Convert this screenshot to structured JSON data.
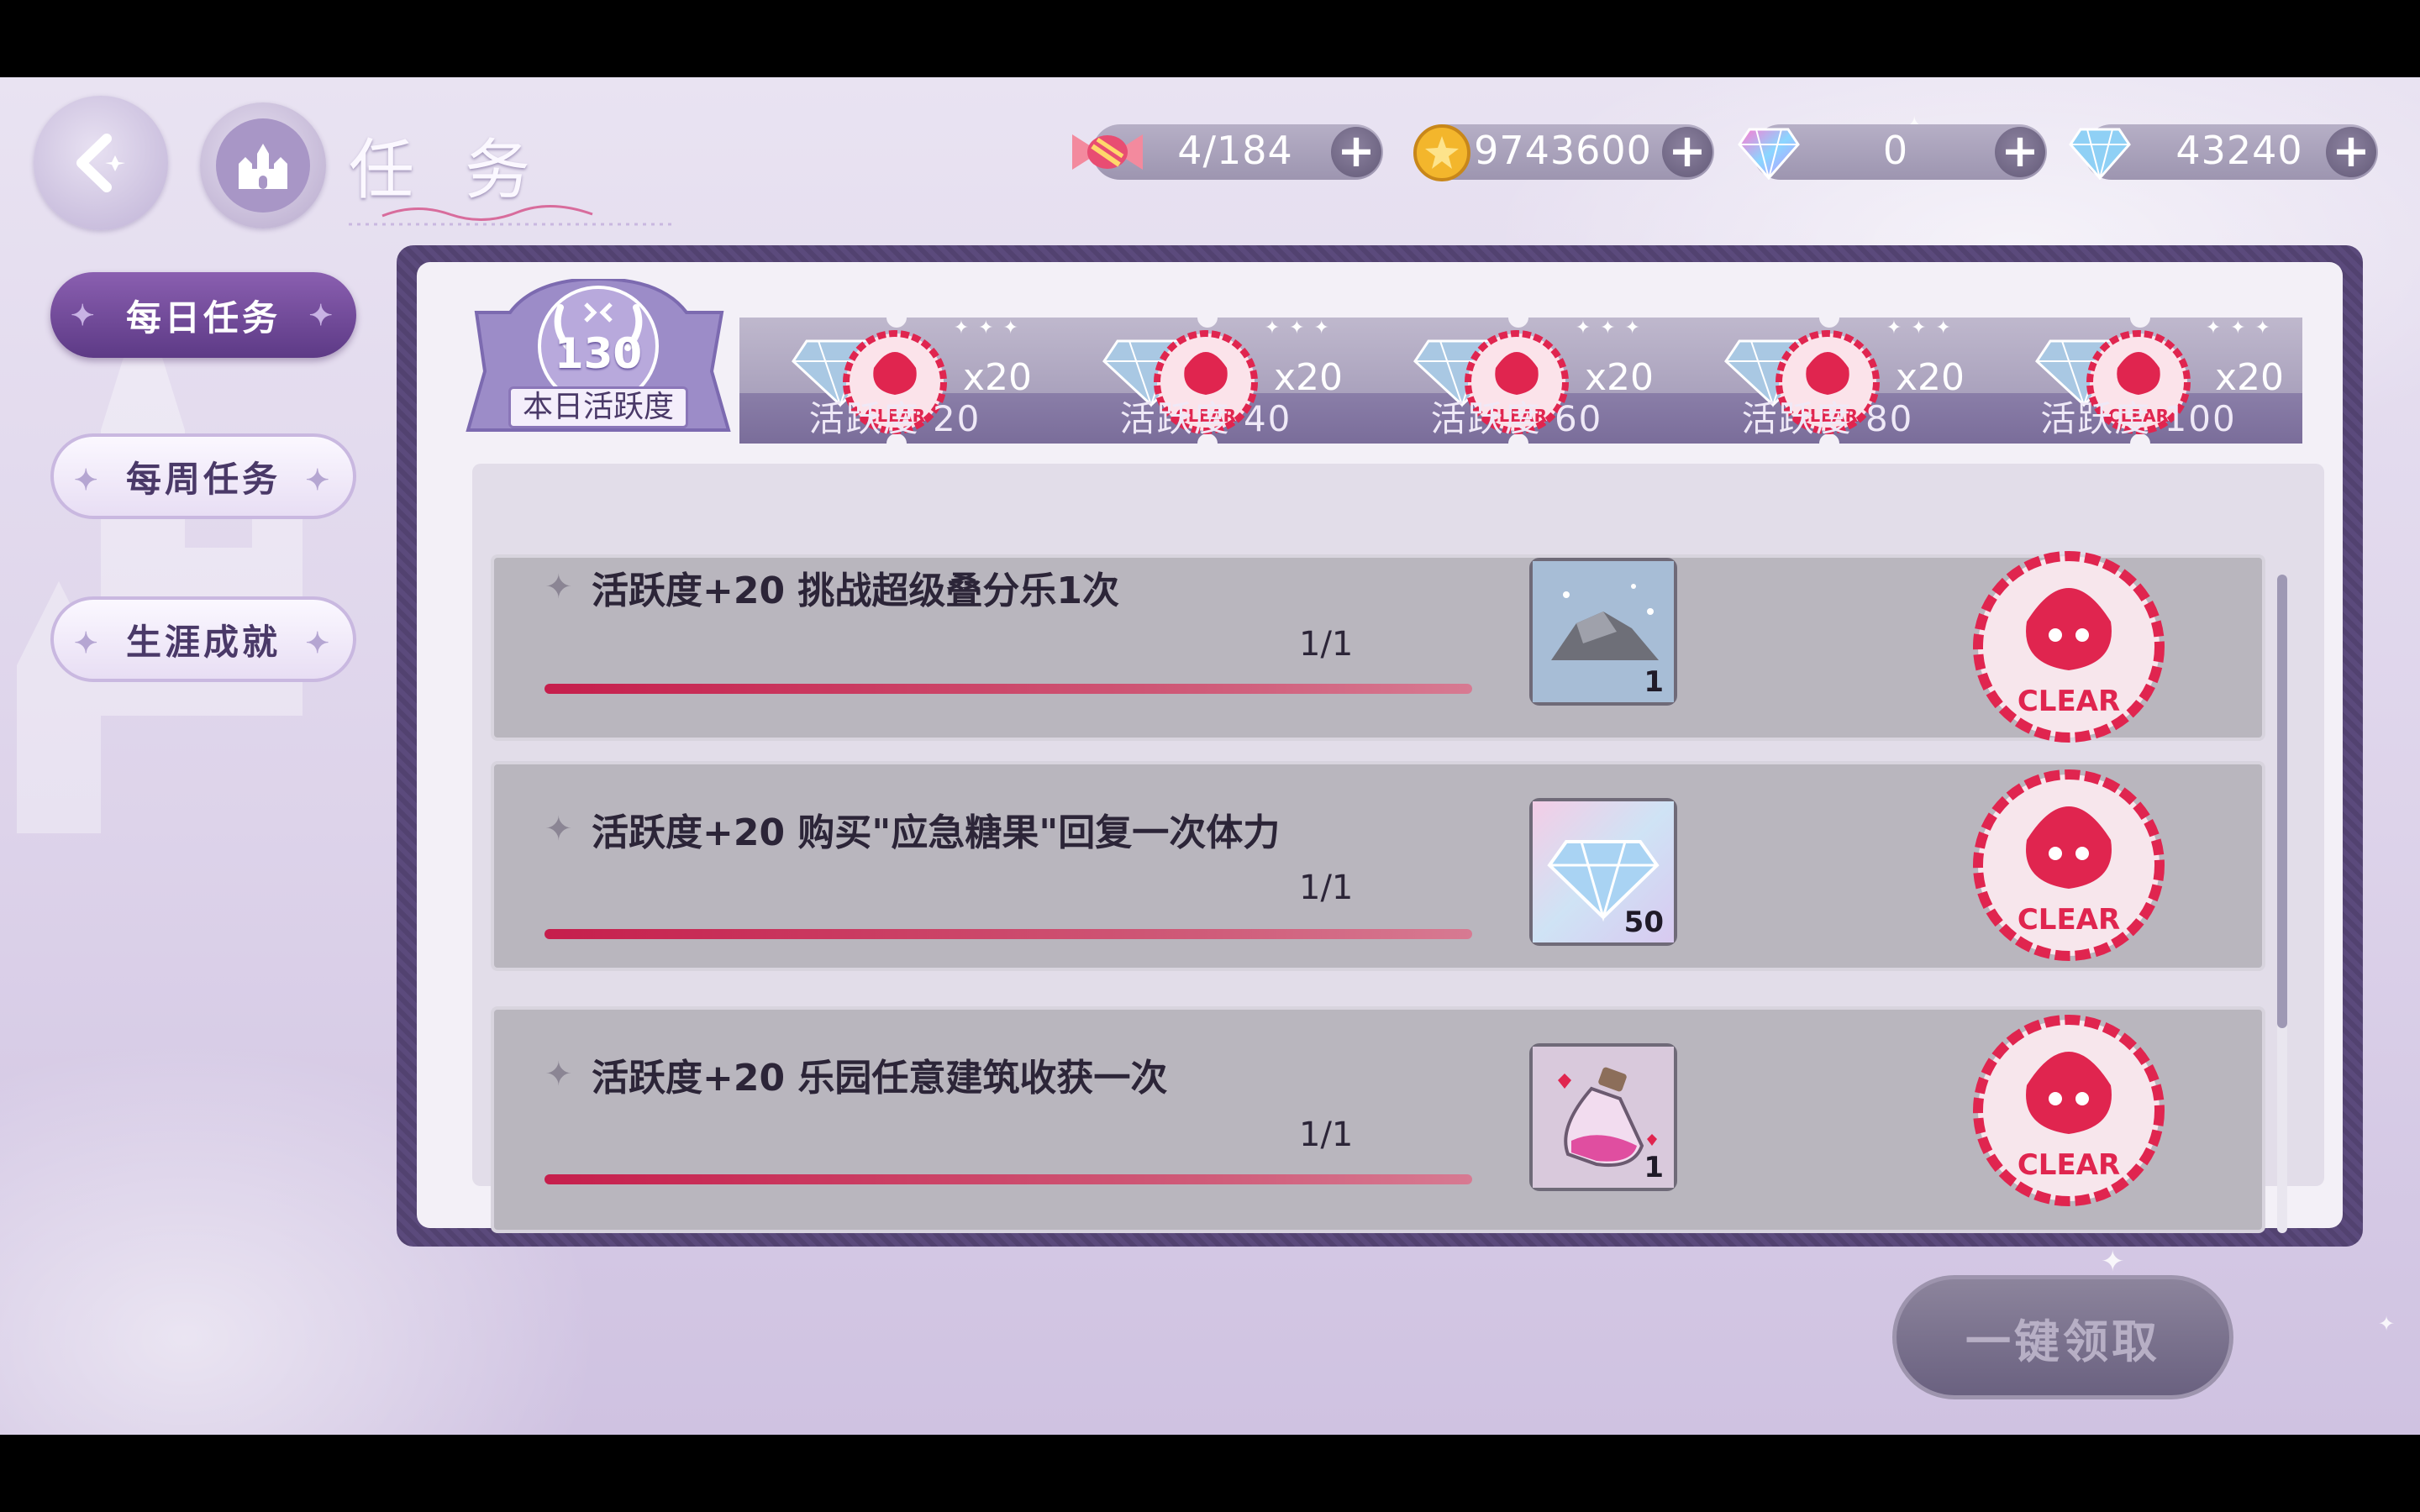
{
  "header": {
    "title": "任务",
    "currencies": [
      {
        "icon": "candy-icon",
        "value": "4/184"
      },
      {
        "icon": "coin-icon",
        "value": "9743600"
      },
      {
        "icon": "rainbow-gem-icon",
        "value": "0"
      },
      {
        "icon": "diamond-icon",
        "value": "43240"
      }
    ],
    "plus": "+"
  },
  "sidebar": {
    "tabs": [
      {
        "label": "每日任务",
        "active": true
      },
      {
        "label": "每周任务",
        "active": false
      },
      {
        "label": "生涯成就",
        "active": false
      }
    ]
  },
  "activity": {
    "score": "130",
    "label": "本日活跃度",
    "milestones": [
      {
        "label": "活跃度 20",
        "reward": "x20",
        "claimed": true
      },
      {
        "label": "活跃度 40",
        "reward": "x20",
        "claimed": true
      },
      {
        "label": "活跃度 60",
        "reward": "x20",
        "claimed": true
      },
      {
        "label": "活跃度 80",
        "reward": "x20",
        "claimed": true
      },
      {
        "label": "活跃度 100",
        "reward": "x20",
        "claimed": true
      }
    ]
  },
  "tasks": [
    {
      "title": "活跃度+20 挑战超级叠分乐1次",
      "progress": "1/1",
      "progress_fraction": 1.0,
      "reward_icon": "ore-icon",
      "reward_qty": "1",
      "status": "CLEAR"
    },
    {
      "title": "活跃度+20 购买\"应急糖果\"回复一次体力",
      "progress": "1/1",
      "progress_fraction": 1.0,
      "reward_icon": "diamond-icon",
      "reward_qty": "50",
      "status": "CLEAR"
    },
    {
      "title": "活跃度+20 乐园任意建筑收获一次",
      "progress": "1/1",
      "progress_fraction": 1.0,
      "reward_icon": "potion-icon",
      "reward_qty": "1",
      "status": "CLEAR"
    }
  ],
  "claim_all_label": "一键领取",
  "stamp_text": "CLEAR",
  "colors": {
    "accent": "#6b4a94",
    "progress": "#c61e4c",
    "stamp": "#e0254f"
  }
}
